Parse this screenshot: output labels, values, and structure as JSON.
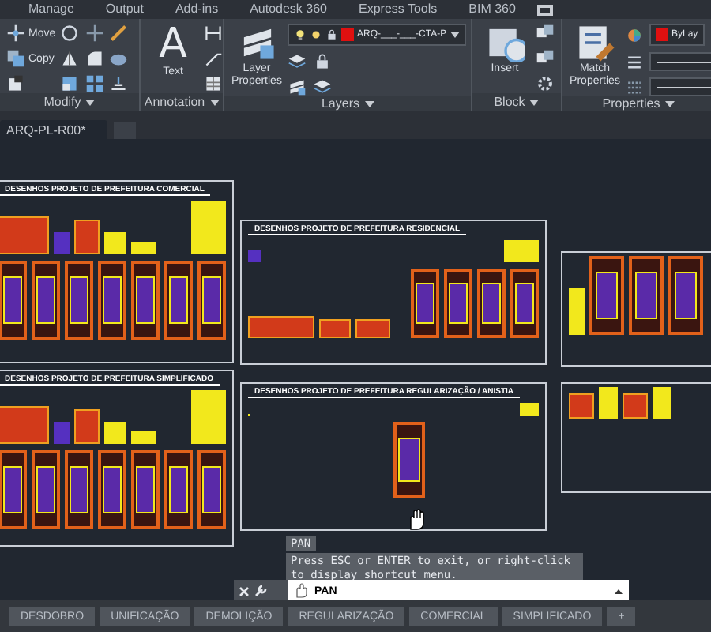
{
  "ribbon": {
    "tabs": [
      {
        "label": "Manage",
        "selected": false
      },
      {
        "label": "Output",
        "selected": false
      },
      {
        "label": "Add-ins",
        "selected": false
      },
      {
        "label": "Autodesk 360",
        "selected": false
      },
      {
        "label": "Express Tools",
        "selected": false
      },
      {
        "label": "BIM 360",
        "selected": false
      }
    ],
    "panels": [
      {
        "kind": "modify",
        "title": "Modify",
        "tools": [
          {
            "label": "Move"
          },
          {
            "label": "Copy"
          }
        ]
      },
      {
        "kind": "annotation",
        "title": "Annotation",
        "tools": [
          {
            "label": "Text",
            "glyph": "A"
          }
        ]
      },
      {
        "kind": "layers",
        "title": "Layers",
        "tools": [
          {
            "label": "Layer Properties"
          }
        ],
        "layer": "ARQ-___-___-CTA-P"
      },
      {
        "kind": "block",
        "title": "Block",
        "tools": [
          {
            "label": "Insert"
          }
        ]
      },
      {
        "kind": "properties",
        "title": "Properties",
        "tools": [
          {
            "label": "Match Properties"
          }
        ],
        "color_value": "ByLay"
      }
    ]
  },
  "file_tabs": [
    {
      "label": "ARQ-PL-R00*",
      "selected": true
    }
  ],
  "canvas": {
    "sheets": [
      {
        "kind": "full",
        "title": "DESENHOS PROJETO DE PREFEITURA COMERCIAL"
      },
      {
        "kind": "sparse",
        "title": "DESENHOS PROJETO DE PREFEITURA RESIDENCIAL"
      },
      {
        "kind": "panels"
      },
      {
        "kind": "full",
        "title": "DESENHOS PROJETO DE PREFEITURA SIMPLIFICADO"
      },
      {
        "kind": "single",
        "title": "DESENHOS PROJETO DE PREFEITURA REGULARIZAÇÃO / ANISTIA"
      },
      {
        "kind": "details"
      }
    ]
  },
  "command_tooltip": {
    "command": "PAN",
    "message": "Press ESC or ENTER to exit, or right-click to display shortcut menu."
  },
  "command_line": {
    "value": "PAN"
  },
  "layout_tabs": [
    {
      "label": "DESDOBRO",
      "selected": false
    },
    {
      "label": "UNIFICAÇÃO",
      "selected": false
    },
    {
      "label": "DEMOLIÇÃO",
      "selected": false
    },
    {
      "label": "REGULARIZAÇÃO",
      "selected": false
    },
    {
      "label": "COMERCIAL",
      "selected": false
    },
    {
      "label": "SIMPLIFICADO",
      "selected": false
    },
    {
      "label": "+",
      "selected": false
    }
  ]
}
